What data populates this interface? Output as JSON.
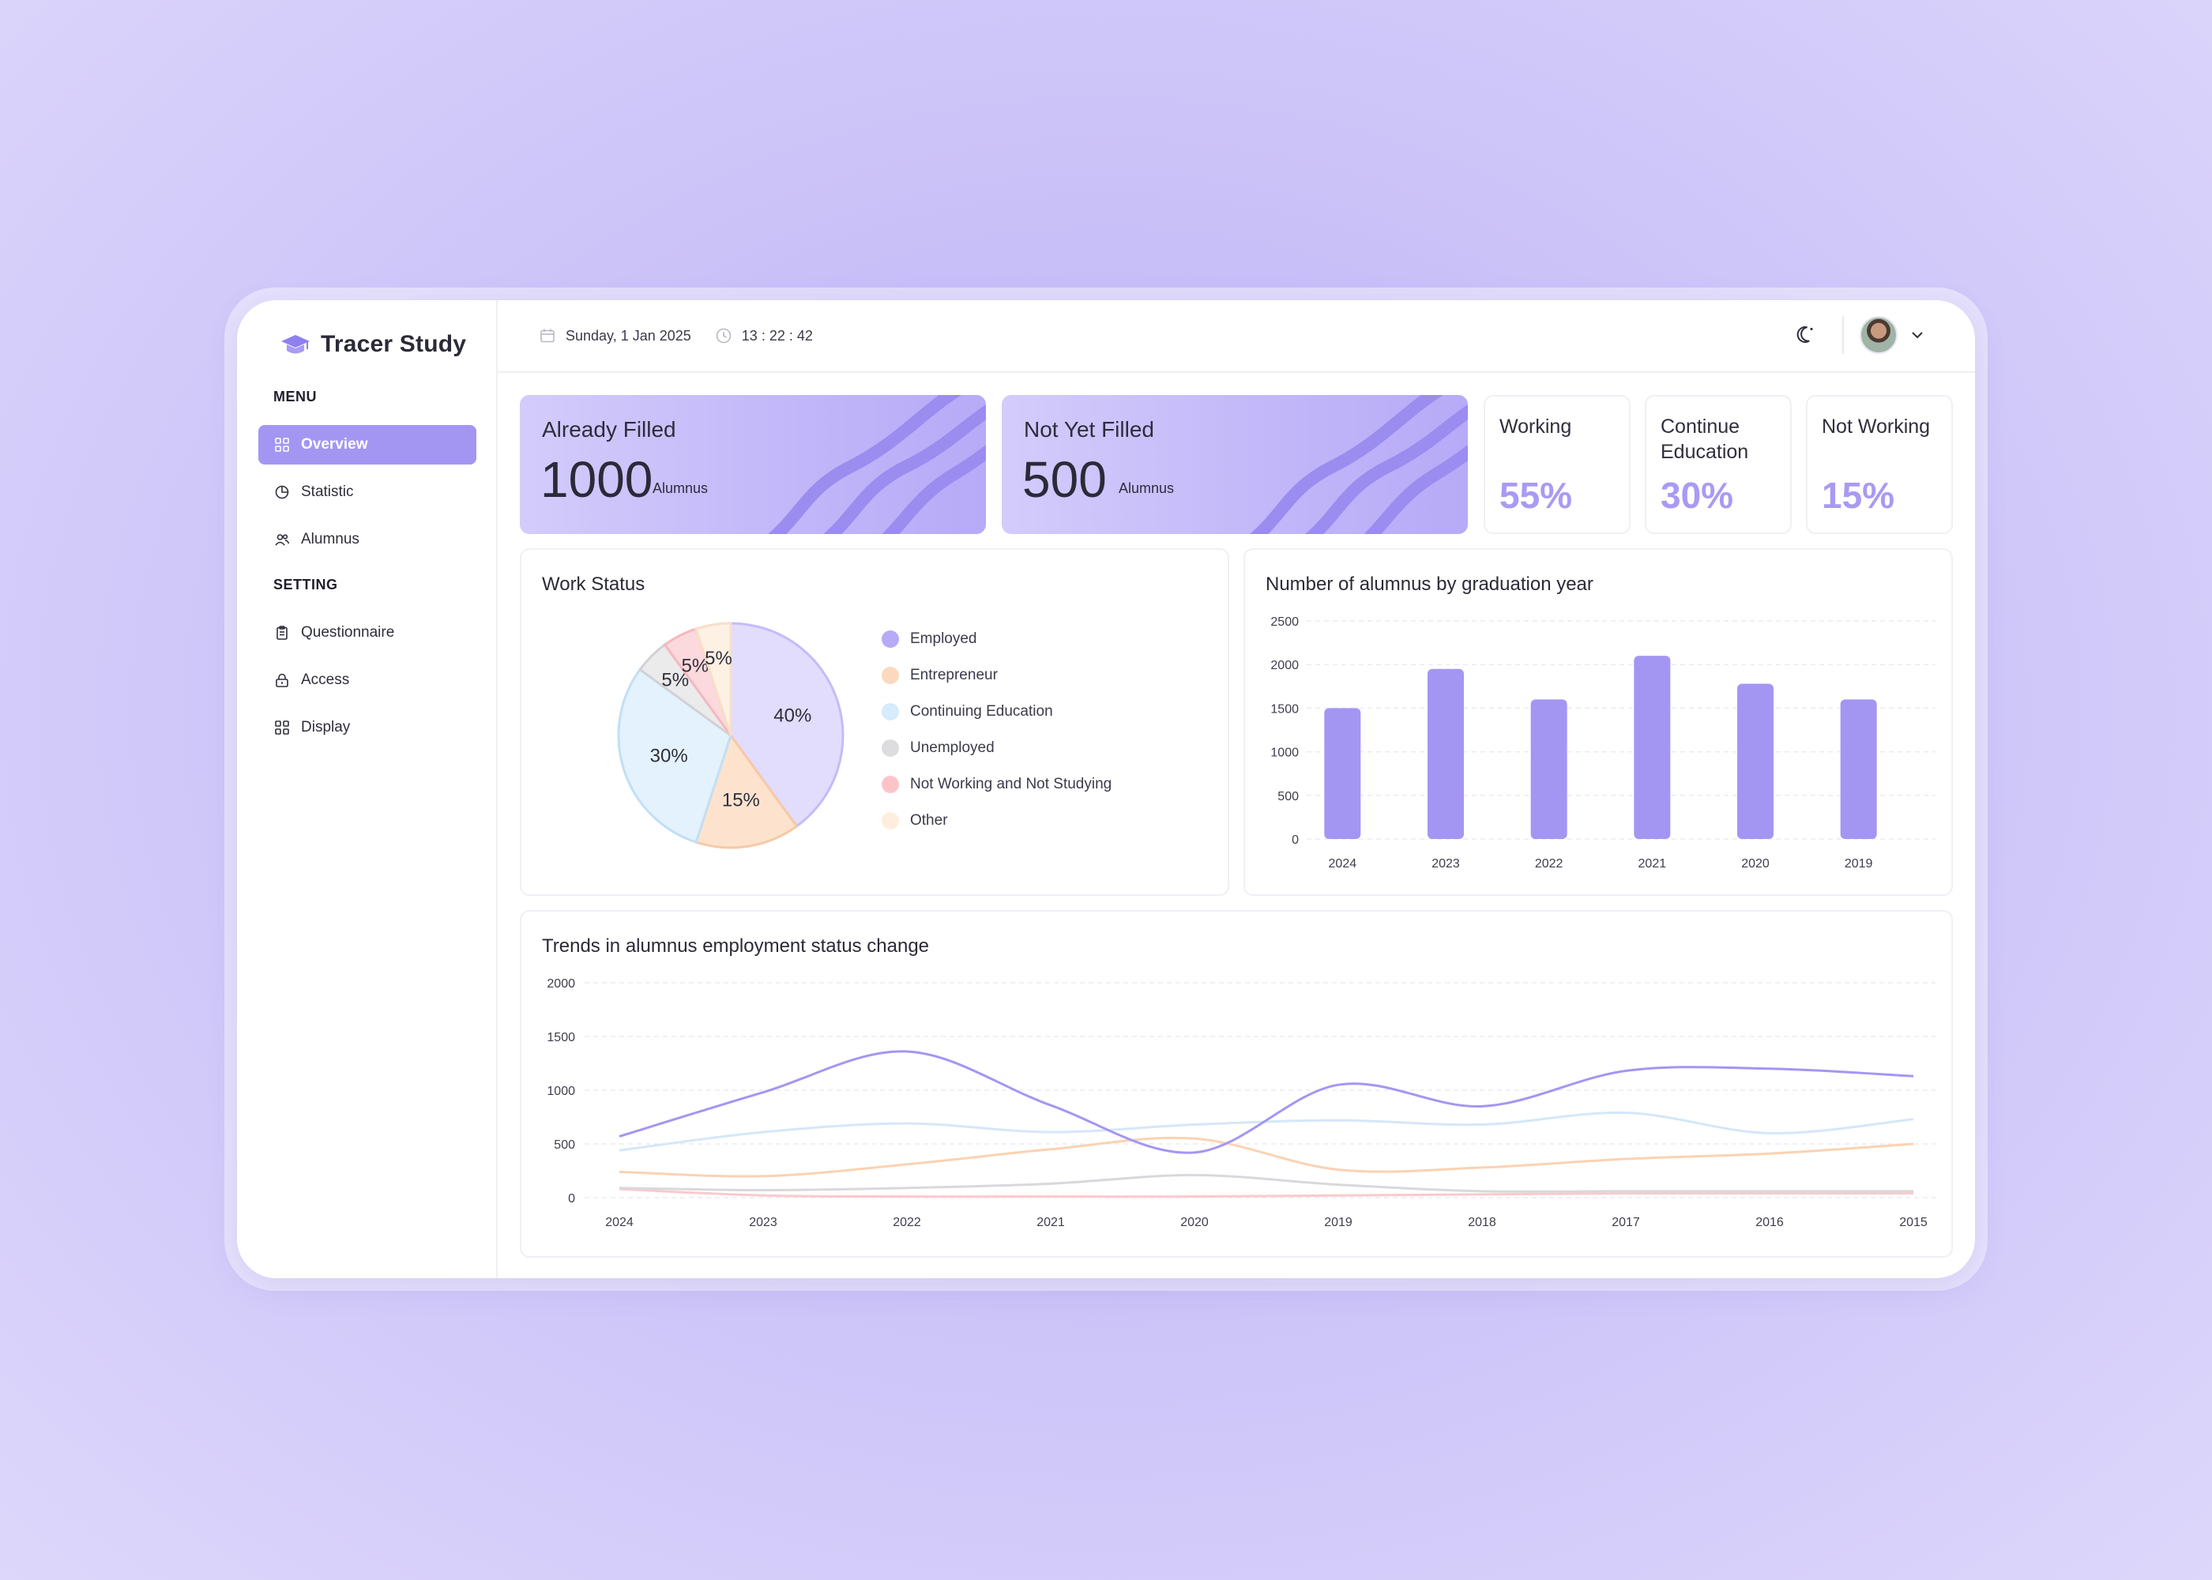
{
  "app": {
    "name": "Tracer Study"
  },
  "sidebar": {
    "menu_label": "MENU",
    "setting_label": "SETTING",
    "menu_items": [
      {
        "label": "Overview",
        "icon": "grid-icon",
        "active": true
      },
      {
        "label": "Statistic",
        "icon": "pie-chart-icon"
      },
      {
        "label": "Alumnus",
        "icon": "users-icon"
      }
    ],
    "setting_items": [
      {
        "label": "Questionnaire",
        "icon": "clipboard-icon"
      },
      {
        "label": "Access",
        "icon": "lock-icon"
      },
      {
        "label": "Display",
        "icon": "grid-icon"
      }
    ]
  },
  "topbar": {
    "date": "Sunday, 1 Jan 2025",
    "time": "13 : 22 : 42"
  },
  "cards": {
    "already_filled": {
      "title": "Already Filled",
      "value": "1000",
      "unit": "Alumnus"
    },
    "not_yet_filled": {
      "title": "Not Yet Filled",
      "value": "500",
      "unit": "Alumnus"
    },
    "working": {
      "title": "Working",
      "value": "55%"
    },
    "continue_education": {
      "title": "Continue Education",
      "value": "30%"
    },
    "not_working": {
      "title": "Not Working",
      "value": "15%"
    }
  },
  "colors": {
    "accent": "#a396f3",
    "employed": "#b7aaf6",
    "entrepreneur": "#fcd9bd",
    "continuing_education": "#d6ebfb",
    "unemployed": "#dddcde",
    "not_working": "#fcc4c9",
    "other": "#fdeede"
  },
  "chart_data": [
    {
      "type": "pie",
      "title": "Work Status",
      "labels": [
        "Employed",
        "Entrepreneur",
        "Continuing Education",
        "Unemployed",
        "Not Working and Not Studying",
        "Other"
      ],
      "values": [
        40,
        15,
        30,
        5,
        5,
        5
      ],
      "value_labels": [
        "40%",
        "15%",
        "30%",
        "5%",
        "5%",
        "5%"
      ],
      "colors": [
        "#e2dcfd",
        "#fde3cd",
        "#e3f2fd",
        "#ebebec",
        "#fcd9dc",
        "#fdf1e4"
      ],
      "legend": "right"
    },
    {
      "type": "bar",
      "title": "Number of alumnus by graduation year",
      "categories": [
        "2024",
        "2023",
        "2022",
        "2021",
        "2020",
        "2019"
      ],
      "values": [
        1500,
        1950,
        1600,
        2100,
        1780,
        1600
      ],
      "ylim": [
        0,
        2500
      ],
      "yticks": [
        "2500",
        "2000",
        "1500",
        "1000",
        "500",
        "0"
      ],
      "grid": true,
      "color": "#a396f3"
    },
    {
      "type": "line",
      "title": "Trends in alumnus employment status change",
      "x": [
        "2024",
        "2023",
        "2022",
        "2021",
        "2020",
        "2019",
        "2018",
        "2017",
        "2016",
        "2015"
      ],
      "ylim": [
        0,
        2000
      ],
      "yticks": [
        "2000",
        "1500",
        "1000",
        "500",
        "0"
      ],
      "grid": true,
      "series": [
        {
          "values": [
            570,
            980,
            1360,
            860,
            420,
            1050,
            850,
            1180,
            1200,
            1130
          ],
          "color": "#a396f3"
        },
        {
          "values": [
            440,
            610,
            690,
            610,
            680,
            720,
            680,
            790,
            600,
            730
          ],
          "color": "#d5e7f8"
        },
        {
          "values": [
            240,
            200,
            310,
            450,
            550,
            260,
            280,
            360,
            410,
            500
          ],
          "color": "#fbd2b2"
        },
        {
          "values": [
            90,
            70,
            90,
            130,
            210,
            120,
            60,
            60,
            60,
            60
          ],
          "color": "#d9d8dc"
        },
        {
          "values": [
            80,
            20,
            10,
            10,
            10,
            20,
            30,
            40,
            40,
            40
          ],
          "color": "#fbc9cd"
        }
      ]
    }
  ]
}
